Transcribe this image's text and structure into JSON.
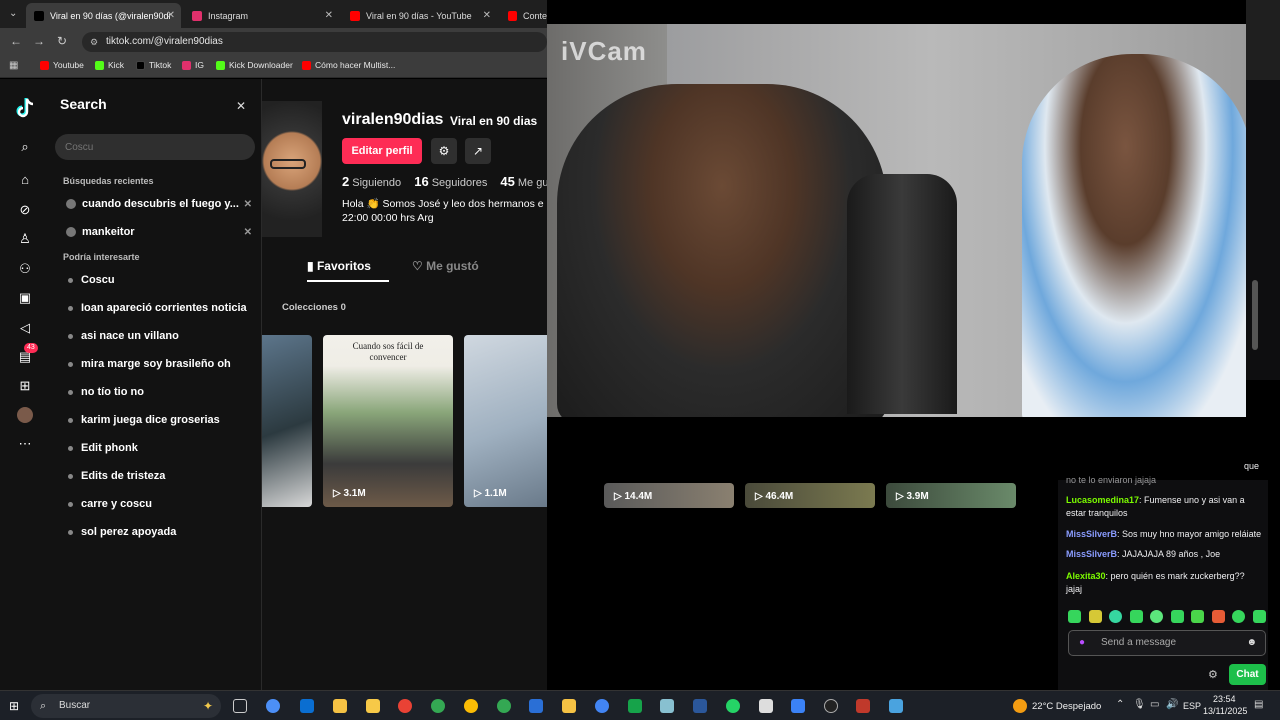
{
  "browser": {
    "tabs": [
      {
        "label": "Viral en 90 días (@viralen90di",
        "color": "#000000"
      },
      {
        "label": "Instagram",
        "color": "#e1306c"
      },
      {
        "label": "Viral en 90 días - YouTube",
        "color": "#ff0000"
      },
      {
        "label": "Conte",
        "color": "#ff0000"
      }
    ],
    "url": "tiktok.com/@viralen90dias",
    "bookmarks": [
      {
        "label": "Youtube",
        "color": "#ff0000"
      },
      {
        "label": "Kick",
        "color": "#53fc18"
      },
      {
        "label": "Tiktok",
        "color": "#000000"
      },
      {
        "label": "IG",
        "color": "#e1306c"
      },
      {
        "label": "Kick Downloader",
        "color": "#53fc18"
      },
      {
        "label": "Cómo hacer Multist...",
        "color": "#ff0000"
      }
    ]
  },
  "search": {
    "title": "Search",
    "placeholder": "Coscu",
    "recent_heading": "Búsquedas recientes",
    "recent": [
      "cuando descubris el fuego y...",
      "mankeitor"
    ],
    "suggested_heading": "Podría interesarte",
    "suggestions": [
      "Coscu",
      "Ioan apareció corrientes noticia",
      "asi nace un villano",
      "mira marge soy brasileño oh",
      "no tío tio no",
      "karim juega dice groserias",
      "Edit phonk",
      "Edits de tristeza",
      "carre y coscu",
      "sol perez apoyada"
    ]
  },
  "profile": {
    "username": "viralen90dias",
    "nickname": "Viral en 90 dias",
    "edit_label": "Editar perfil",
    "following_count": "2",
    "following_label": "Siguiendo",
    "followers_count": "16",
    "followers_label": "Seguidores",
    "likes_count": "45",
    "likes_label": "Me gu",
    "bio_line1": "Hola 👏 Somos José y leo dos hermanos e",
    "bio_line2": "22:00 00:00 hrs Arg",
    "tab_favorites": "Favoritos",
    "tab_liked": "Me gustó",
    "collections": "Colecciones 0",
    "notification_badge": "43",
    "videos": [
      {
        "views": "",
        "caption": ""
      },
      {
        "views": "3.1M",
        "caption": "Cuando sos fácil de convencer"
      },
      {
        "views": "1.1M",
        "caption": ""
      },
      {
        "views": "14.4M",
        "caption": ""
      },
      {
        "views": "46.4M",
        "caption": ""
      },
      {
        "views": "3.9M",
        "caption": ""
      }
    ]
  },
  "webcam": {
    "logo": "iVCam"
  },
  "chat": {
    "partial_top": "que",
    "partial_line": "no te lo enviaron jajaja",
    "messages": [
      {
        "user": "Lucasomedina17",
        "text": ": Fumense uno y asi van a estar tranquilos",
        "color": "#7cfc00"
      },
      {
        "user": "MissSilverB",
        "text": ": Sos muy hno mayor amigo reláiate",
        "color": "#8a9cff"
      },
      {
        "user": "MissSilverB",
        "text": ": JAJAJAJA 89 años , Joe",
        "color": "#8a9cff"
      },
      {
        "user": "Alexita30",
        "text": ": pero quién es mark zuckerberg?? jajaj",
        "color": "#7cfc00"
      }
    ],
    "send_placeholder": "Send a message",
    "chat_button": "Chat"
  },
  "taskbar": {
    "search_label": "Buscar",
    "weather": "22°C Despejado",
    "language": "ESP",
    "time": "23:54",
    "date": "13/11/2025"
  }
}
